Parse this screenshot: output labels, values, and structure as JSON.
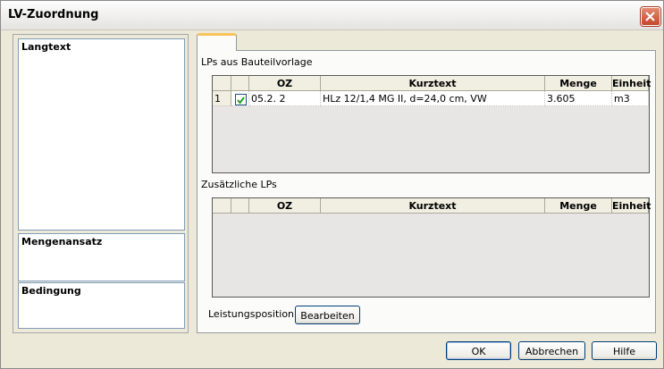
{
  "window": {
    "title": "LV-Zuordnung"
  },
  "left": {
    "langtext_label": "Langtext",
    "mengenansatz_label": "Mengenansatz",
    "bedingung_label": "Bedingung"
  },
  "tab": {
    "label": ""
  },
  "bauteilvorlage": {
    "label": "LPs aus Bauteilvorlage",
    "columns": [
      "",
      "",
      "OZ",
      "Kurztext",
      "Menge",
      "Einheit"
    ],
    "rows": [
      {
        "index": "1",
        "checked": true,
        "oz": "05.2.  2",
        "kurztext": "HLz 12/1,4 MG II, d=24,0 cm, VW",
        "menge": "3.605",
        "einheit": "m3"
      }
    ]
  },
  "zusaetzliche": {
    "label": "Zusätzliche LPs",
    "columns": [
      "",
      "",
      "OZ",
      "Kurztext",
      "Menge",
      "Einheit"
    ],
    "rows": []
  },
  "leistungsposition": {
    "label": "Leistungsposition",
    "button": "Bearbeiten"
  },
  "footer": {
    "ok": "OK",
    "cancel": "Abbrechen",
    "help": "Hilfe"
  }
}
